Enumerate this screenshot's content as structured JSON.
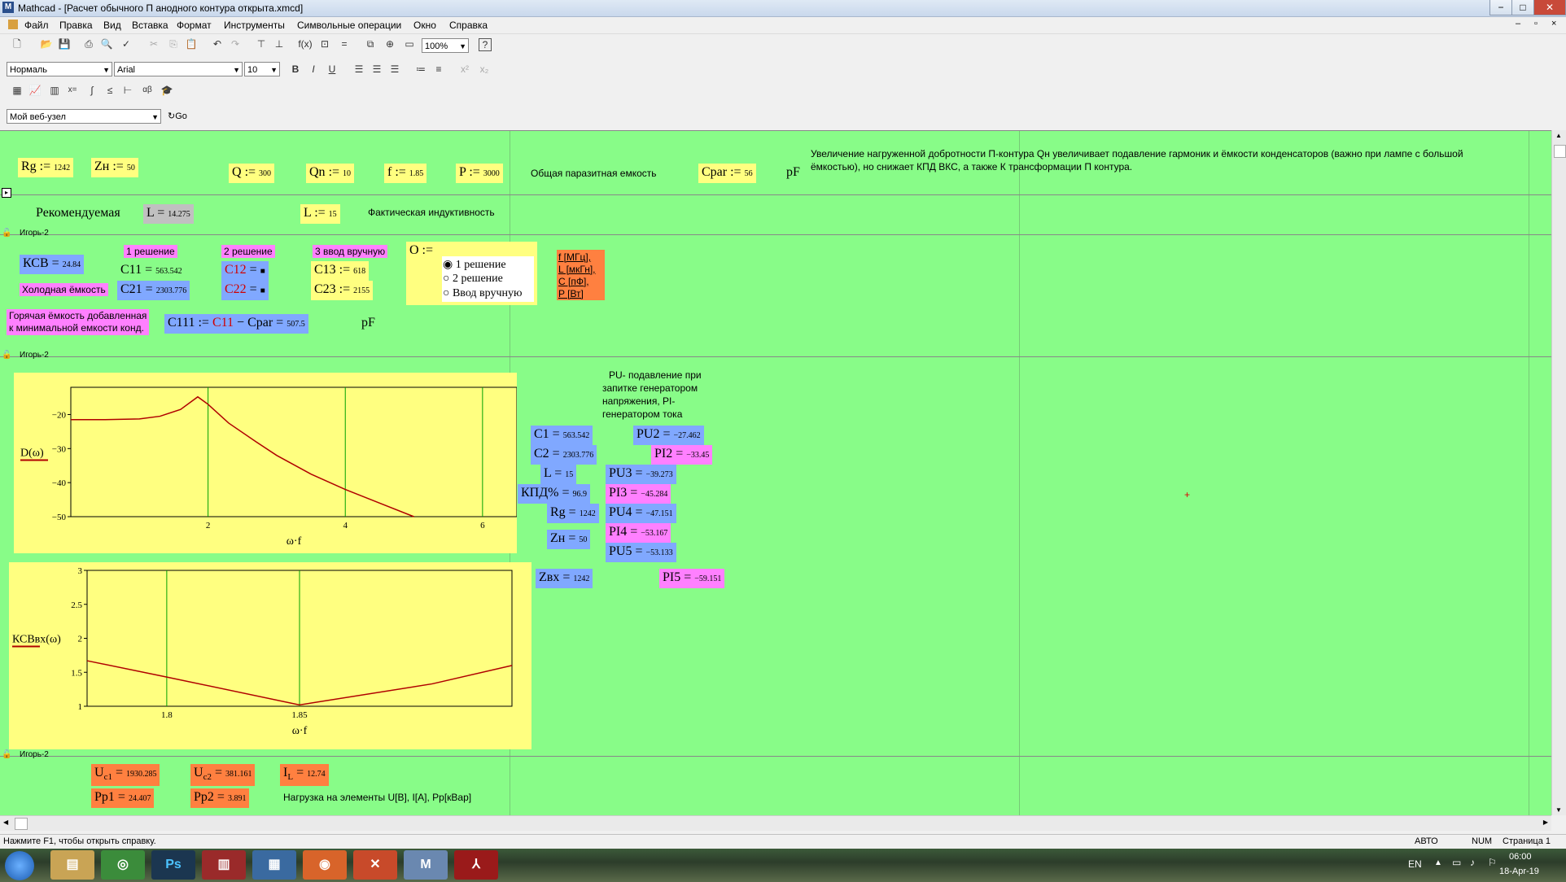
{
  "window": {
    "title": "Mathcad - [Расчет обычного П анодного контура открыта.xmcd]",
    "app_icon": "mathcad-icon",
    "buttons": [
      "−",
      "□",
      "✕"
    ]
  },
  "menu": [
    "Файл",
    "Правка",
    "Вид",
    "Вставка",
    "Формат",
    "Инструменты",
    "Символьные операции",
    "Окно",
    "Справка"
  ],
  "toolbar": {
    "zoom": "100%",
    "style": "Нормаль",
    "font": "Arial",
    "font_size": "10",
    "bold": "B",
    "italic": "I",
    "underline": "U",
    "web_url": "Мой веб-узел",
    "go": "Go"
  },
  "regions": {
    "rg": {
      "name": "Rg",
      "op": ":=",
      "value": "1242"
    },
    "zn": {
      "name": "Zн",
      "op": ":=",
      "value": "50"
    },
    "q": {
      "name": "Q",
      "op": ":=",
      "value": "300"
    },
    "qn": {
      "name": "Qn",
      "op": ":=",
      "value": "10"
    },
    "f": {
      "name": "f",
      "op": ":=",
      "value": "1.85"
    },
    "p": {
      "name": "P",
      "op": ":=",
      "value": "3000"
    },
    "cpar_label": "Общая паразитная емкость",
    "cpar": {
      "name": "Cpar",
      "op": ":=",
      "value": "56"
    },
    "cpar_unit": "pF",
    "note": "Увеличение нагруженной добротности П-контура Qн увеличивает подавление гармоник и ёмкости конденсаторов (важно при лампе с большой ёмкостью), но снижает КПД ВКС, а также К трансформации П контура.",
    "recommended_label": "Рекомендуемая",
    "l_rec": {
      "name": "L",
      "op": "=",
      "value": "14.275"
    },
    "l_fact": {
      "name": "L",
      "op": ":=",
      "value": "15"
    },
    "l_fact_label": "Фактическая индуктивность",
    "section_label": "Игорь-2",
    "ksv": {
      "name": "КСВ",
      "op": "=",
      "value": "24.84"
    },
    "cold_label": "Холодная ёмкость",
    "sol1_label": "1 решение",
    "sol2_label": "2 решение",
    "sol3_label": "3 ввод вручную",
    "c11": {
      "name": "C11",
      "op": "=",
      "value": "563.542"
    },
    "c21": {
      "name": "C21",
      "op": "=",
      "value": "2303.776"
    },
    "c12": {
      "name": "C12",
      "op": "=",
      "value": "■"
    },
    "c22": {
      "name": "C22",
      "op": "=",
      "value": "■"
    },
    "c13": {
      "name": "C13",
      "op": ":=",
      "value": "618"
    },
    "c23": {
      "name": "C23",
      "op": ":=",
      "value": "2155"
    },
    "o_label": "O :=",
    "radio_options": [
      "1 решение",
      "2 решение",
      "Ввод вручную"
    ],
    "units_list": [
      "f [МГц],",
      "L [мкГн],",
      "C [пФ],",
      "P [Вт]"
    ],
    "hot_label_1": "Горячая ёмкость добавленная",
    "hot_label_2": "к минимальной емкости конд.",
    "c111": {
      "name": "C111",
      "op": ":=",
      "expr_a": "C11",
      "minus": "−",
      "expr_b": "Cpar",
      "eq": "=",
      "value": "507.5"
    },
    "c111_unit": "pF",
    "pu_note": [
      "PU- подавление при",
      "запитке генератором",
      "напряжения, PI-",
      "генератором тока"
    ],
    "results_left": [
      {
        "name": "C1",
        "op": "=",
        "value": "563.542"
      },
      {
        "name": "C2",
        "op": "=",
        "value": "2303.776"
      },
      {
        "name": "L",
        "op": "=",
        "value": "15"
      },
      {
        "name": "КПД%",
        "op": "=",
        "value": "96.9"
      },
      {
        "name": "Rg",
        "op": "=",
        "value": "1242"
      },
      {
        "name": "Zн",
        "op": "=",
        "value": "50"
      },
      {
        "name": "Zвх",
        "op": "=",
        "value": "1242"
      }
    ],
    "pu2": {
      "name": "PU2",
      "op": "=",
      "value": "−27.462"
    },
    "pi2": {
      "name": "PI2",
      "op": "=",
      "value": "−33.45"
    },
    "pu3": {
      "name": "PU3",
      "op": "=",
      "value": "−39.273"
    },
    "pi3": {
      "name": "PI3",
      "op": "=",
      "value": "−45.284"
    },
    "pu4": {
      "name": "PU4",
      "op": "=",
      "value": "−47.151"
    },
    "pi4": {
      "name": "PI4",
      "op": "=",
      "value": "−53.167"
    },
    "pu5": {
      "name": "PU5",
      "op": "=",
      "value": "−53.133"
    },
    "pi5": {
      "name": "PI5",
      "op": "=",
      "value": "−59.151"
    },
    "uc1": {
      "name": "U",
      "sub": "c1",
      "op": "=",
      "value": "1930.285"
    },
    "uc2": {
      "name": "U",
      "sub": "c2",
      "op": "=",
      "value": "381.161"
    },
    "il": {
      "name": "I",
      "sub": "L",
      "op": "=",
      "value": "12.74"
    },
    "pp1": {
      "name": "Pp1",
      "op": "=",
      "value": "24.407"
    },
    "pp2": {
      "name": "Pp2",
      "op": "=",
      "value": "3.891"
    },
    "load_label": "Нагрузка на элементы U[В], I[А], Pp[кВар]"
  },
  "chart_data": [
    {
      "type": "line",
      "ylabel": "D(ω)",
      "xlabel": "ω·f",
      "xlim": [
        0,
        6.5
      ],
      "ylim": [
        -50,
        -12
      ],
      "xticks": [
        2,
        4,
        6
      ],
      "yticks": [
        -20,
        -30,
        -40,
        -50
      ],
      "grid": true,
      "series": [
        {
          "x": [
            0,
            0.5,
            1.0,
            1.3,
            1.6,
            1.85,
            2.0,
            2.3,
            2.7,
            3.0,
            3.5,
            4.0,
            4.5,
            5.0
          ],
          "y": [
            -21.5,
            -21.5,
            -21.3,
            -20.5,
            -18.5,
            -14.8,
            -17,
            -22.5,
            -28,
            -32,
            -37.5,
            -42,
            -46,
            -50
          ]
        }
      ]
    },
    {
      "type": "line",
      "ylabel": "КСВвх(ω)",
      "xlabel": "ω·f",
      "xlim": [
        1.77,
        1.93
      ],
      "ylim": [
        1,
        3
      ],
      "xticks": [
        1.8,
        1.85
      ],
      "yticks": [
        1,
        1.5,
        2,
        2.5,
        3
      ],
      "grid": true,
      "series": [
        {
          "x": [
            1.77,
            1.8,
            1.85,
            1.9,
            1.93
          ],
          "y": [
            1.67,
            1.43,
            1.02,
            1.33,
            1.6
          ]
        }
      ]
    }
  ],
  "status": {
    "help": "Нажмите F1, чтобы открыть справку.",
    "mode": "АВТО",
    "num": "NUM",
    "page": "Страница 1"
  },
  "taskbar": {
    "lang": "EN",
    "time": "06:00",
    "date": "18-Apr-19",
    "apps": [
      "start-icon",
      "explorer-icon",
      "chrome-icon",
      "photoshop-icon",
      "book-icon",
      "network-icon",
      "firefox-icon",
      "media-icon",
      "mathcad-icon",
      "acrobat-icon"
    ]
  }
}
